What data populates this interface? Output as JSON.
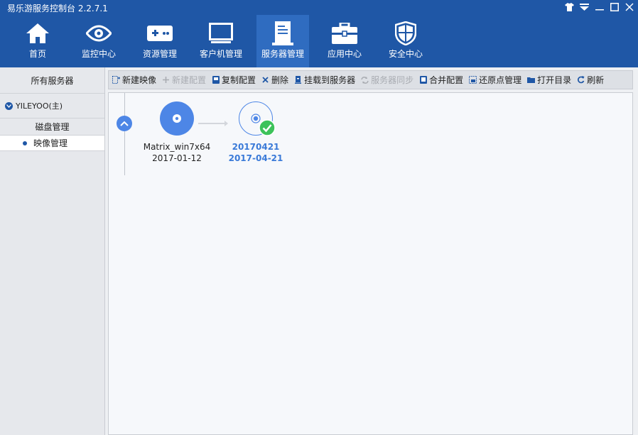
{
  "app": {
    "title": "易乐游服务控制台 2.2.7.1"
  },
  "window_controls": [
    "shirt-icon",
    "menu-icon",
    "minimize-icon",
    "maximize-icon",
    "close-icon"
  ],
  "nav": {
    "items": [
      {
        "label": "首页",
        "icon": "home-icon"
      },
      {
        "label": "监控中心",
        "icon": "eye-icon"
      },
      {
        "label": "资源管理",
        "icon": "gamepad-icon"
      },
      {
        "label": "客户机管理",
        "icon": "monitor-icon"
      },
      {
        "label": "服务器管理",
        "icon": "server-icon",
        "active": true
      },
      {
        "label": "应用中心",
        "icon": "toolbox-icon"
      },
      {
        "label": "安全中心",
        "icon": "shield-icon"
      }
    ]
  },
  "sidebar": {
    "header": "所有服务器",
    "server": "YILEYOO(主)",
    "items": [
      {
        "label": "磁盘管理"
      },
      {
        "label": "映像管理",
        "active": true
      }
    ]
  },
  "toolbar": {
    "buttons": [
      {
        "label": "新建映像",
        "icon": "new-image-icon",
        "enabled": true
      },
      {
        "label": "新建配置",
        "icon": "plus-icon",
        "enabled": false
      },
      {
        "label": "复制配置",
        "icon": "copy-icon",
        "enabled": true
      },
      {
        "label": "删除",
        "icon": "x-icon",
        "enabled": true
      },
      {
        "label": "挂载到服务器",
        "icon": "mount-icon",
        "enabled": true
      },
      {
        "label": "服务器同步",
        "icon": "sync-icon",
        "enabled": false
      },
      {
        "label": "合并配置",
        "icon": "merge-icon",
        "enabled": true
      },
      {
        "label": "还原点管理",
        "icon": "restore-icon",
        "enabled": true
      },
      {
        "label": "打开目录",
        "icon": "folder-icon",
        "enabled": true
      },
      {
        "label": "刷新",
        "icon": "refresh-icon",
        "enabled": true
      }
    ]
  },
  "images": [
    {
      "name": "Matrix_win7x64",
      "date": "2017-01-12"
    },
    {
      "name": "20170421",
      "date": "2017-04-21",
      "selected": true
    }
  ],
  "colors": {
    "primary": "#1f57a6",
    "active_tab": "#2f6cc0",
    "accent": "#4d86e6",
    "check": "#3cc25a"
  }
}
